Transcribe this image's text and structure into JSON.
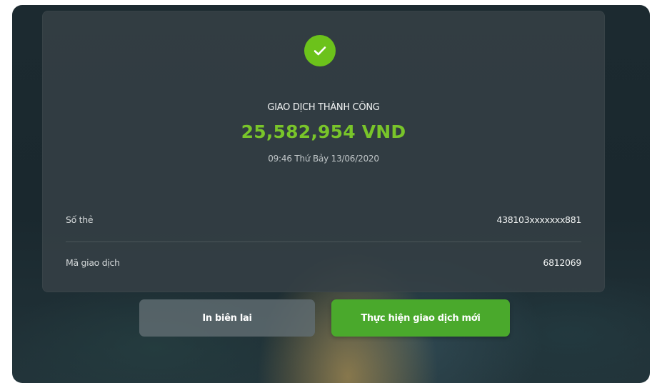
{
  "result": {
    "icon": "check-icon",
    "status_title": "GIAO DỊCH THÀNH CÔNG",
    "amount": "25,582,954 VND",
    "datetime": "09:46 Thứ Bảy 13/06/2020",
    "colors": {
      "success_green": "#6cc21b",
      "amount_green": "#79c52a",
      "primary_button": "#4aa92c"
    }
  },
  "details": [
    {
      "label": "Số thẻ",
      "value": "438103xxxxxxx881"
    },
    {
      "label": "Mã giao dịch",
      "value": "6812069"
    }
  ],
  "actions": {
    "print_label": "In biên lai",
    "new_transaction_label": "Thực hiện giao dịch mới"
  }
}
